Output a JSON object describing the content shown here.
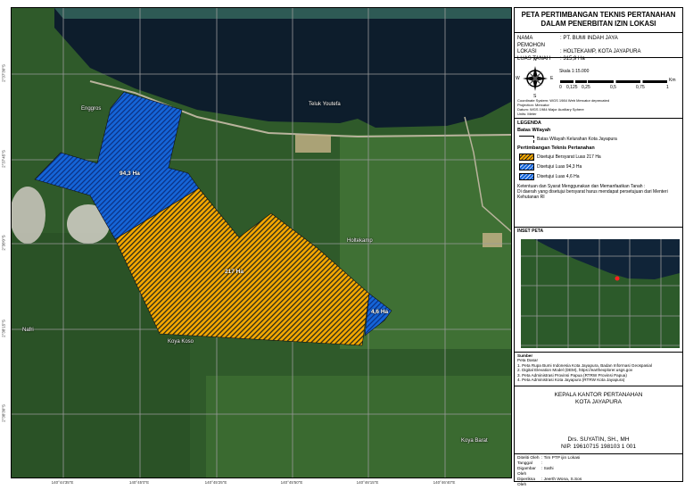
{
  "map": {
    "places": [
      {
        "name": "Enggros"
      },
      {
        "name": "Teluk Youtefa"
      },
      {
        "name": "Holtekamp"
      },
      {
        "name": "Nafri"
      },
      {
        "name": "Koya Koso"
      },
      {
        "name": "Koya Barat"
      }
    ],
    "areas": [
      {
        "label": "94,3 Ha",
        "color": "#1565d8"
      },
      {
        "label": "217 Ha",
        "color": "#f4a800"
      },
      {
        "label": "4,6 Ha",
        "color": "#1565d8"
      }
    ],
    "lon_ticks": [
      "140°44'35\"E",
      "140°45'0\"E",
      "140°45'25\"E",
      "140°45'50\"E",
      "140°46'15\"E",
      "140°46'40\"E"
    ],
    "lat_ticks": [
      "2°37'30\"S",
      "2°37'45\"S",
      "2°38'0\"S",
      "2°38'15\"S",
      "2°38'30\"S"
    ]
  },
  "panel": {
    "title_line1": "PETA PERTIMBANGAN TEKNIS PERTANAHAN",
    "title_line2": "DALAM PENERBITAN IZIN LOKASI",
    "info": [
      {
        "k": "NAMA PEMOHON",
        "v": ": PT. BUMI INDAH JAYA"
      },
      {
        "k": "LOKASI",
        "v": ": HOLTEKAMP, KOTA JAYAPURA"
      },
      {
        "k": "LUAS TANAH",
        "v": ": 315,9 Ha"
      }
    ],
    "compass": {
      "n": "N",
      "s": "S",
      "e": "E",
      "w": "W"
    },
    "scale": {
      "label": "Skala  1:15.000",
      "unit": "Km",
      "ticks": [
        "0",
        "0,125",
        "0,25",
        "0,5",
        "0,75",
        "1"
      ]
    },
    "coords": [
      "Coordinate System: WGS 1984 Web Mercator deprecated",
      "Projection: Mercator",
      "Datum: WGS 1984 Major Auxiliary Sphere",
      "Units: Meter"
    ],
    "legend": {
      "title": "LEGENDA",
      "group1": "Batas Wilayah",
      "boundary": "Batas Wilayah Kelurahan Kota Jayapura",
      "group2": "Pertimbangan Teknis Pertanahan",
      "items": [
        "Disetujui Bersyarat Luas 217 Ha",
        "Disetujui Luas 94,3 Ha",
        "Disetujui Luas 4,6 Ha"
      ],
      "note1": "Ketentuan dan Syarat Menggunakan dan Memanfaatkan Tanah :",
      "note2": "Di daerah yang disetujui bersyarat harus mendapat persetujuan dari Menteri Kehutanan RI"
    },
    "inset": {
      "title": "INSET PETA",
      "accent": "#ff2020"
    },
    "sources": {
      "title": "Sumber",
      "sub": "Peta Dasar",
      "items": [
        "1. Peta Rupa Bumi Indonesia Kota Jayapura, Badan Informasi Geospasial",
        "2. Digital Elevation Model (DEM), https://earthexplorer.usgs.gov",
        "3. Peta Administrasi Provinsi  Papua (RTRW Provinsi Papua)",
        "4. Peta Administrasi Kota Jayapura (RTRW Kota Jayapura)"
      ]
    },
    "signature": {
      "office1": "KEPALA KANTOR PERTANAHAN",
      "office2": "KOTA JAYAPURA",
      "name": "Drs. SUYATIN, SH., MH",
      "nip": "NIP. 19610715 198103 1 001"
    },
    "footer": [
      {
        "k": "Diteliti Oleh",
        "v": ": Tim PTP ijin Lokasi"
      },
      {
        "k": "Tanggal",
        "v": ":"
      },
      {
        "k": "Digambar Oleh",
        "v": ": Sathi"
      },
      {
        "k": "Diperiksa Oleh",
        "v": ": Jeerth Wona, S.Sos"
      }
    ]
  }
}
